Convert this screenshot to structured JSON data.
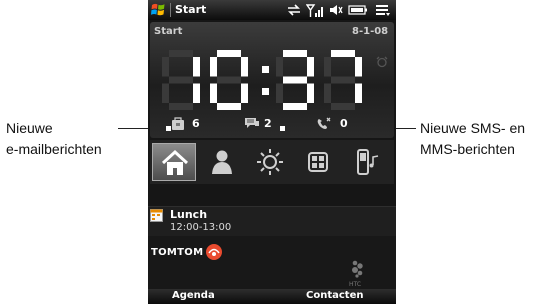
{
  "status_bar": {
    "title": "Start",
    "icons": [
      "windows-start-icon",
      "sync-arrows-icon",
      "signal-icon",
      "volume-icon",
      "battery-icon",
      "menu-icon"
    ]
  },
  "clock": {
    "label": "Start",
    "date": "8-1-08",
    "time": "10:37"
  },
  "notifications": {
    "email_count": "6",
    "sms_count": "2",
    "missed_calls_count": "0"
  },
  "tabs": [
    "home-icon",
    "contacts-icon",
    "weather-sun-icon",
    "launcher-grid-icon",
    "music-phone-icon"
  ],
  "agenda": {
    "title": "Lunch",
    "time": "12:00-13:00"
  },
  "tomtom": {
    "brand": "TOMTOM"
  },
  "softkeys": {
    "left": "Agenda",
    "right": "Contacten"
  },
  "callouts": {
    "left_line1": "Nieuwe",
    "left_line2": "e-mailberichten",
    "right_line1": "Nieuwe SMS- en",
    "right_line2": "MMS-berichten"
  },
  "colors": {
    "screen_bg": "#161616",
    "digit_on": "#ffffff",
    "digit_off": "#3a3a3a",
    "tab_active": "#8c8c8c"
  }
}
